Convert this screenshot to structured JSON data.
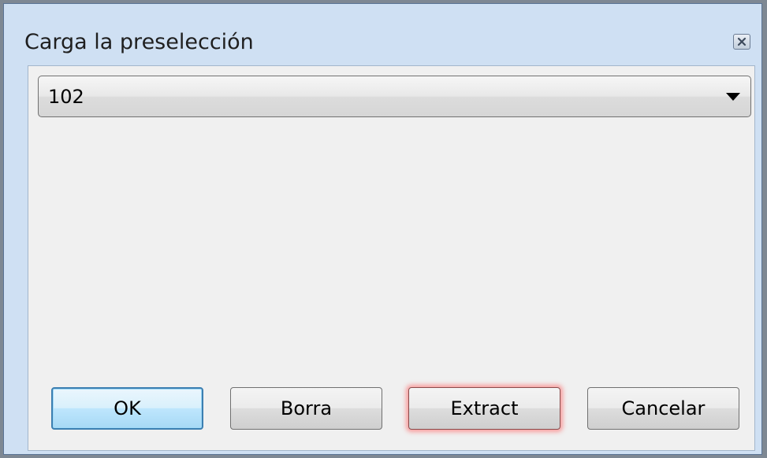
{
  "window": {
    "title": "Carga la preselección",
    "close_icon": "close-icon"
  },
  "preset_select": {
    "selected_value": "102"
  },
  "buttons": {
    "ok_label": "OK",
    "delete_label": "Borra",
    "extract_label": "Extract",
    "cancel_label": "Cancelar"
  },
  "colors": {
    "titlebar": "#cfe0f3",
    "client_bg": "#f0f0f0",
    "default_button_border": "#3c7fb1",
    "extract_glow": "#ff5a5a"
  }
}
